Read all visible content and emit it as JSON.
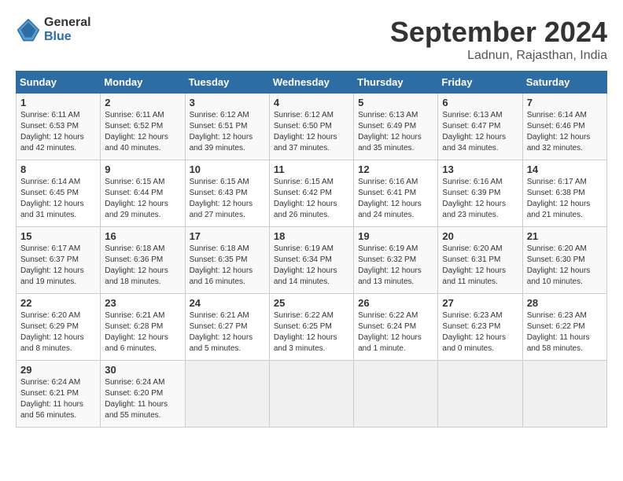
{
  "header": {
    "logo_line1": "General",
    "logo_line2": "Blue",
    "month_title": "September 2024",
    "location": "Ladnun, Rajasthan, India"
  },
  "days_of_week": [
    "Sunday",
    "Monday",
    "Tuesday",
    "Wednesday",
    "Thursday",
    "Friday",
    "Saturday"
  ],
  "weeks": [
    [
      {
        "day": "1",
        "sunrise": "6:11 AM",
        "sunset": "6:53 PM",
        "daylight": "12 hours and 42 minutes."
      },
      {
        "day": "2",
        "sunrise": "6:11 AM",
        "sunset": "6:52 PM",
        "daylight": "12 hours and 40 minutes."
      },
      {
        "day": "3",
        "sunrise": "6:12 AM",
        "sunset": "6:51 PM",
        "daylight": "12 hours and 39 minutes."
      },
      {
        "day": "4",
        "sunrise": "6:12 AM",
        "sunset": "6:50 PM",
        "daylight": "12 hours and 37 minutes."
      },
      {
        "day": "5",
        "sunrise": "6:13 AM",
        "sunset": "6:49 PM",
        "daylight": "12 hours and 35 minutes."
      },
      {
        "day": "6",
        "sunrise": "6:13 AM",
        "sunset": "6:47 PM",
        "daylight": "12 hours and 34 minutes."
      },
      {
        "day": "7",
        "sunrise": "6:14 AM",
        "sunset": "6:46 PM",
        "daylight": "12 hours and 32 minutes."
      }
    ],
    [
      {
        "day": "8",
        "sunrise": "6:14 AM",
        "sunset": "6:45 PM",
        "daylight": "12 hours and 31 minutes."
      },
      {
        "day": "9",
        "sunrise": "6:15 AM",
        "sunset": "6:44 PM",
        "daylight": "12 hours and 29 minutes."
      },
      {
        "day": "10",
        "sunrise": "6:15 AM",
        "sunset": "6:43 PM",
        "daylight": "12 hours and 27 minutes."
      },
      {
        "day": "11",
        "sunrise": "6:15 AM",
        "sunset": "6:42 PM",
        "daylight": "12 hours and 26 minutes."
      },
      {
        "day": "12",
        "sunrise": "6:16 AM",
        "sunset": "6:41 PM",
        "daylight": "12 hours and 24 minutes."
      },
      {
        "day": "13",
        "sunrise": "6:16 AM",
        "sunset": "6:39 PM",
        "daylight": "12 hours and 23 minutes."
      },
      {
        "day": "14",
        "sunrise": "6:17 AM",
        "sunset": "6:38 PM",
        "daylight": "12 hours and 21 minutes."
      }
    ],
    [
      {
        "day": "15",
        "sunrise": "6:17 AM",
        "sunset": "6:37 PM",
        "daylight": "12 hours and 19 minutes."
      },
      {
        "day": "16",
        "sunrise": "6:18 AM",
        "sunset": "6:36 PM",
        "daylight": "12 hours and 18 minutes."
      },
      {
        "day": "17",
        "sunrise": "6:18 AM",
        "sunset": "6:35 PM",
        "daylight": "12 hours and 16 minutes."
      },
      {
        "day": "18",
        "sunrise": "6:19 AM",
        "sunset": "6:34 PM",
        "daylight": "12 hours and 14 minutes."
      },
      {
        "day": "19",
        "sunrise": "6:19 AM",
        "sunset": "6:32 PM",
        "daylight": "12 hours and 13 minutes."
      },
      {
        "day": "20",
        "sunrise": "6:20 AM",
        "sunset": "6:31 PM",
        "daylight": "12 hours and 11 minutes."
      },
      {
        "day": "21",
        "sunrise": "6:20 AM",
        "sunset": "6:30 PM",
        "daylight": "12 hours and 10 minutes."
      }
    ],
    [
      {
        "day": "22",
        "sunrise": "6:20 AM",
        "sunset": "6:29 PM",
        "daylight": "12 hours and 8 minutes."
      },
      {
        "day": "23",
        "sunrise": "6:21 AM",
        "sunset": "6:28 PM",
        "daylight": "12 hours and 6 minutes."
      },
      {
        "day": "24",
        "sunrise": "6:21 AM",
        "sunset": "6:27 PM",
        "daylight": "12 hours and 5 minutes."
      },
      {
        "day": "25",
        "sunrise": "6:22 AM",
        "sunset": "6:25 PM",
        "daylight": "12 hours and 3 minutes."
      },
      {
        "day": "26",
        "sunrise": "6:22 AM",
        "sunset": "6:24 PM",
        "daylight": "12 hours and 1 minute."
      },
      {
        "day": "27",
        "sunrise": "6:23 AM",
        "sunset": "6:23 PM",
        "daylight": "12 hours and 0 minutes."
      },
      {
        "day": "28",
        "sunrise": "6:23 AM",
        "sunset": "6:22 PM",
        "daylight": "11 hours and 58 minutes."
      }
    ],
    [
      {
        "day": "29",
        "sunrise": "6:24 AM",
        "sunset": "6:21 PM",
        "daylight": "11 hours and 56 minutes."
      },
      {
        "day": "30",
        "sunrise": "6:24 AM",
        "sunset": "6:20 PM",
        "daylight": "11 hours and 55 minutes."
      },
      null,
      null,
      null,
      null,
      null
    ]
  ]
}
